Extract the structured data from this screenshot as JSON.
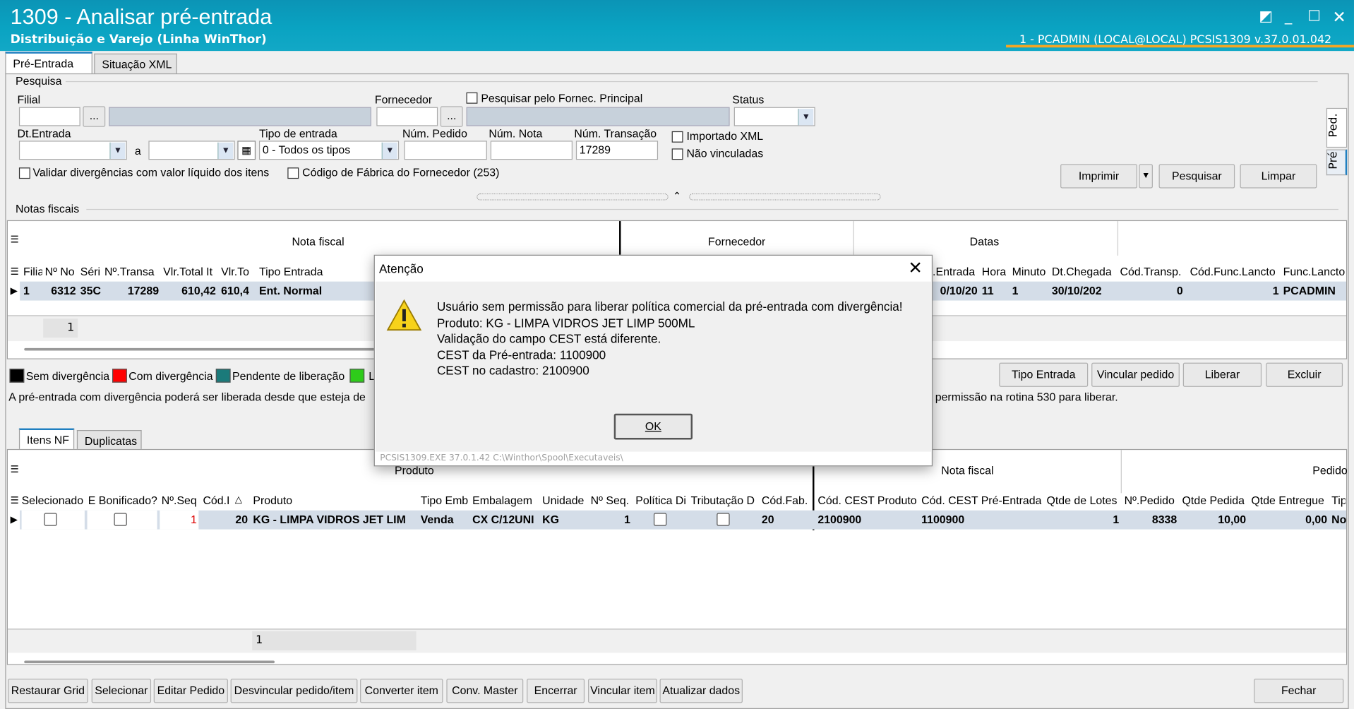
{
  "window": {
    "title": "1309 - Analisar pré-entrada",
    "subtitle": "Distribuição e Varejo (Linha WinThor)",
    "user_info": "1 - PCADMIN (LOCAL@LOCAL)   PCSIS1309  v.37.0.01.042"
  },
  "tabs_top": [
    "Pré-Entrada",
    "Situação XML"
  ],
  "side_tabs": [
    "Ped.",
    "Pré"
  ],
  "search": {
    "section_label": "Pesquisa",
    "filial_label": "Filial",
    "ellipsis": "...",
    "fornecedor_label": "Fornecedor",
    "fornec_principal_label": "Pesquisar pelo Fornec. Principal",
    "status_label": "Status",
    "dt_entrada_label": "Dt.Entrada",
    "a_label": "a",
    "tipo_entrada_label": "Tipo de entrada",
    "tipo_entrada_value": "0 - Todos os tipos",
    "num_pedido_label": "Núm. Pedido",
    "num_nota_label": "Núm. Nota",
    "num_transacao_label": "Núm. Transação",
    "num_transacao_value": "17289",
    "importado_xml": "Importado XML",
    "nao_vinculadas": "Não vinculadas",
    "validar_div": "Validar divergências com valor líquido dos itens",
    "cod_fabrica": "Código de Fábrica do Fornecedor (253)",
    "btn_imprimir": "Imprimir",
    "btn_pesquisar": "Pesquisar",
    "btn_limpar": "Limpar"
  },
  "notas": {
    "section_label": "Notas fiscais",
    "group_nota": "Nota fiscal",
    "group_fornecedor": "Fornecedor",
    "group_datas": "Datas",
    "cols_left": [
      "Filia",
      "Nº No",
      "Séri",
      "Nº.Transa",
      "Vlr.Total It",
      "Vlr.To",
      "Tipo Entrada"
    ],
    "cols_right": [
      ".Entrada",
      "Hora",
      "Minuto",
      "Dt.Chegada",
      "Cód.Transp.",
      "Cód.Func.Lancto",
      "Func.Lancto"
    ],
    "row_left": [
      "1",
      "6312",
      "35C",
      "17289",
      "610,42",
      "610,4",
      "Ent. Normal"
    ],
    "row_right": [
      "0/10/20",
      "11",
      "1",
      "30/10/202",
      "0",
      "1",
      "PCADMIN"
    ],
    "footer_count": "1"
  },
  "legend": [
    {
      "color": "#000000",
      "label": "Sem divergência"
    },
    {
      "color": "#ff0000",
      "label": "Com divergência"
    },
    {
      "color": "#1b7a7a",
      "label": "Pendente de liberação"
    },
    {
      "color": "#2ecc1a",
      "label": "L"
    }
  ],
  "info_text_left": "A pré-entrada com divergência poderá ser liberada desde que esteja de",
  "info_text_right": "permissão na rotina 530 para liberar.",
  "notas_buttons": [
    "Tipo Entrada",
    "Vincular pedido",
    "Liberar",
    "Excluir"
  ],
  "tabs_bottom": [
    "Itens NF",
    "Duplicatas"
  ],
  "itens": {
    "group_produto": "Produto",
    "group_nota": "Nota fiscal",
    "group_pedido": "Pedido",
    "cols": [
      "Selecionado",
      "E Bonificado?",
      "Nº.Seq",
      "Cód.I",
      "Produto",
      "Tipo Emb",
      "Embalagem",
      "Unidade",
      "Nº Seq.",
      "Política Di",
      "Tributação D",
      "Cód.Fab.",
      "Cód. CEST Produto",
      "Cód. CEST Pré-Entrada",
      "Qtde de Lotes",
      "Nº.Pedido",
      "Qtde Pedida",
      "Qtde Entregue",
      "Tip"
    ],
    "row": {
      "seq": "1",
      "cod": "20",
      "produto": "KG - LIMPA VIDROS JET LIM",
      "tipo_emb": "Venda",
      "embalagem": "CX C/12UNI",
      "unidade": "KG",
      "nseq": "1",
      "cod_fab": "20",
      "cest_prod": "2100900",
      "cest_pre": "1100900",
      "lotes": "1",
      "pedido": "8338",
      "qtde_pedida": "10,00",
      "qtde_entregue": "0,00",
      "tip": "Nor"
    },
    "footer_count": "1"
  },
  "bottom_buttons": [
    "Restaurar Grid",
    "Selecionar",
    "Editar Pedido",
    "Desvincular pedido/item",
    "Converter item",
    "Conv. Master",
    "Encerrar",
    "Vincular item",
    "Atualizar dados"
  ],
  "btn_fechar": "Fechar",
  "dialog": {
    "title": "Atenção",
    "lines": [
      "Usuário sem permissão para liberar política comercial da pré-entrada com divergência!",
      "Produto: KG - LIMPA VIDROS JET LIMP 500ML",
      "Validação do campo CEST está diferente.",
      "CEST da Pré-entrada: 1100900",
      "CEST no cadastro: 2100900"
    ],
    "ok": "OK",
    "path": "PCSIS1309.EXE 37.0.1.42 C:\\Winthor\\Spool\\Executaveis\\"
  },
  "colors": {
    "titlebar": "#0b9ebd",
    "accent": "#f5a623",
    "selected_row": "#d4dde8"
  }
}
